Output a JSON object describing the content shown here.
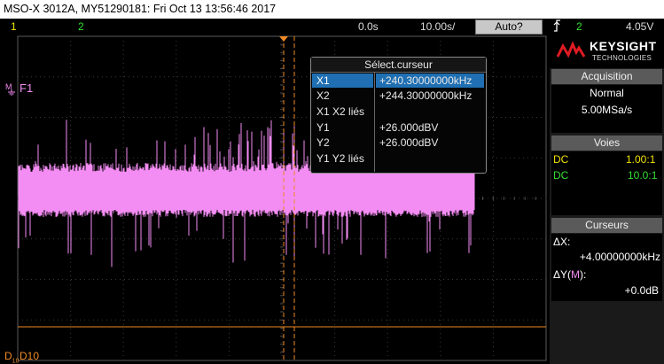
{
  "title_bar": {
    "text": "MSO-X 3012A, MY51290181: Fri Oct 13 13:56:46 2017"
  },
  "status_bar": {
    "ch1": "1",
    "ch2": "2",
    "time_delay": "0.0s",
    "time_per_div": "10.00s/",
    "trigger_mode": "Auto?",
    "trigger_icon": "trigger-edge-icon",
    "trigger_channel": "2",
    "trigger_level": "4.05V"
  },
  "display": {
    "math_label": "F1",
    "digital_label": "D10",
    "digital_prefix": "D",
    "trace_color": "#f38cf3",
    "cursor_color": "#f08a24"
  },
  "cursor_dialog": {
    "title": "Sélect.curseur",
    "rows": [
      {
        "label": "X1",
        "value": "+240.30000000kHz",
        "selected": true
      },
      {
        "label": "X2",
        "value": "+244.30000000kHz"
      },
      {
        "label": "X1 X2 liés",
        "value": ""
      },
      {
        "label": "Y1",
        "value": "+26.000dBV"
      },
      {
        "label": "Y2",
        "value": "+26.000dBV"
      },
      {
        "label": "Y1 Y2 liés",
        "value": ""
      }
    ]
  },
  "brand": {
    "name": "KEYSIGHT",
    "sub": "TECHNOLOGIES"
  },
  "acquisition": {
    "title": "Acquisition",
    "mode": "Normal",
    "rate": "5.00MSa/s"
  },
  "channels": {
    "title": "Voies",
    "items": [
      {
        "coupling": "DC",
        "ratio": "1.00:1",
        "color": "#f0e000"
      },
      {
        "coupling": "DC",
        "ratio": "10.0:1",
        "color": "#33dd33"
      }
    ]
  },
  "cursors": {
    "title": "Curseurs",
    "dx_label": "ΔX:",
    "dx_value": "+4.00000000kHz",
    "dy_label_prefix": "ΔY(",
    "dy_label_mid": "M",
    "dy_label_suffix": "):",
    "dy_value": "+0.0dB"
  }
}
